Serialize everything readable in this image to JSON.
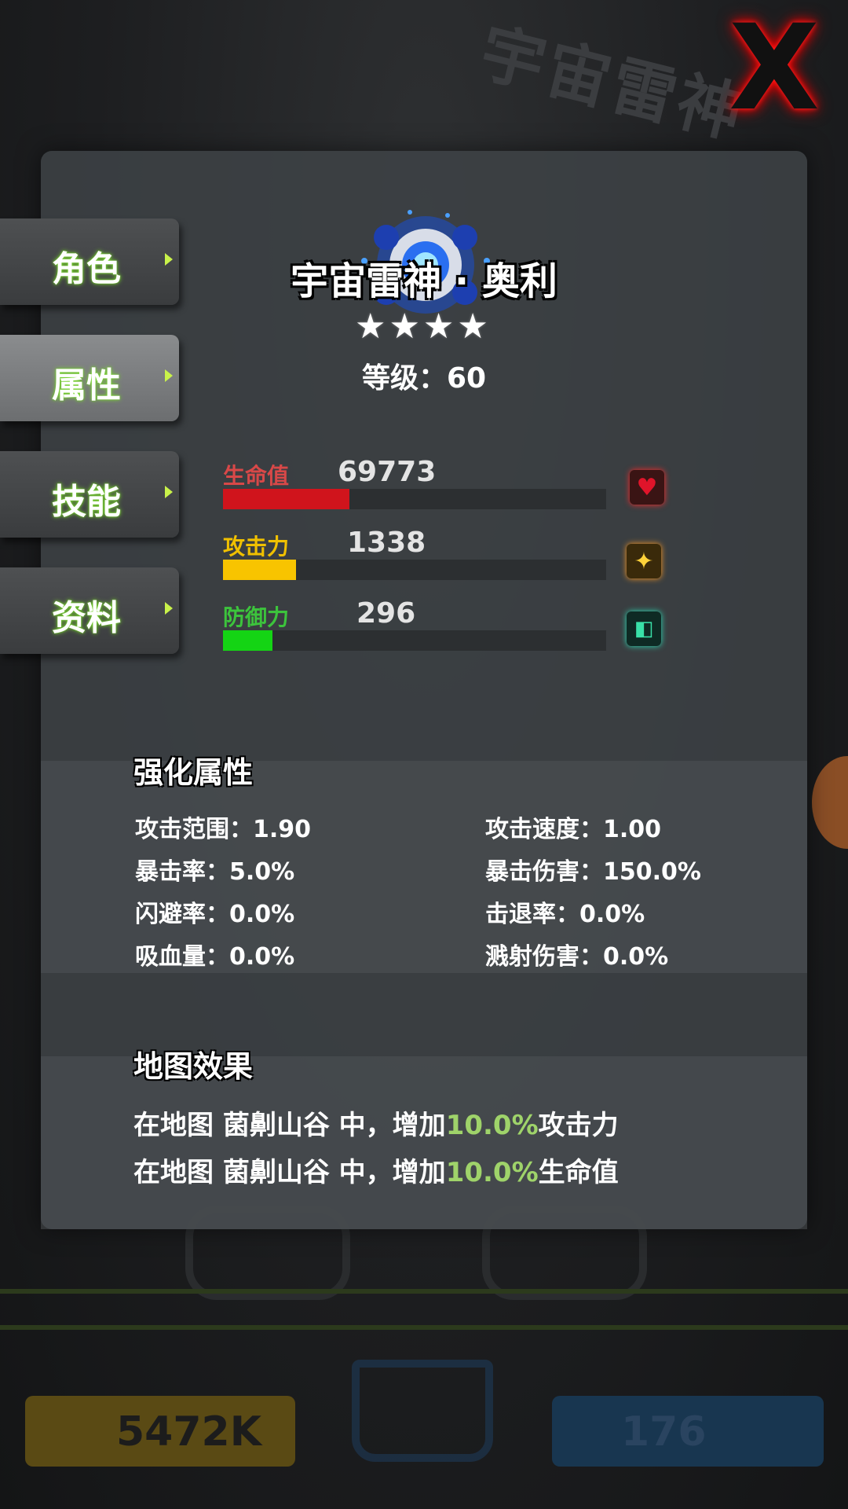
{
  "background": {
    "title_watermark": "宇宙雷神",
    "gold_count": "5472K",
    "gem_count": "176"
  },
  "tabs": [
    {
      "label": "角色",
      "active": false
    },
    {
      "label": "属性",
      "active": true
    },
    {
      "label": "技能",
      "active": false
    },
    {
      "label": "资料",
      "active": false
    }
  ],
  "hero": {
    "name": "宇宙雷神 · 奥利",
    "stars": 4,
    "level_text": "等级：60"
  },
  "stats": {
    "hp": {
      "label": "生命值",
      "value": "69773",
      "fill": 0.33,
      "color": "#d0141c",
      "label_color": "#d84848",
      "icon": "heart-icon"
    },
    "atk": {
      "label": "攻击力",
      "value": "1338",
      "fill": 0.19,
      "color": "#f8c400",
      "label_color": "#f0c000",
      "icon": "sparkle-icon"
    },
    "def": {
      "label": "防御力",
      "value": "296",
      "fill": 0.13,
      "color": "#14d414",
      "label_color": "#3cc43c",
      "icon": "shield-icon"
    }
  },
  "enhanced": {
    "title": "强化属性",
    "left": [
      "攻击范围：1.90",
      "暴击率：5.0%",
      "闪避率：0.0%",
      "吸血量：0.0%"
    ],
    "right": [
      "攻击速度：1.00",
      "暴击伤害：150.0%",
      "击退率：0.0%",
      "溅射伤害：0.0%"
    ]
  },
  "map_effect": {
    "title": "地图效果",
    "lines": [
      {
        "prefix": "在地图 菌劓山谷 中，增加",
        "value": "10.0%",
        "suffix": "攻击力"
      },
      {
        "prefix": "在地图 菌劓山谷 中，增加",
        "value": "10.0%",
        "suffix": "生命值"
      }
    ]
  },
  "close_label": "X"
}
